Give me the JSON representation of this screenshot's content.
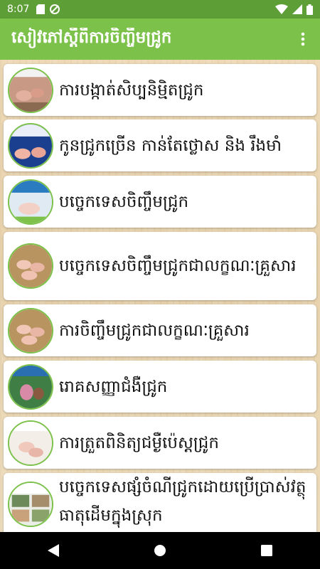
{
  "status_bar": {
    "time": "8:07",
    "icons": [
      "sd-card-icon",
      "sync-disabled-icon",
      "wifi-icon",
      "signal-icon",
      "battery-icon"
    ]
  },
  "app_bar": {
    "title": "សៀវភៅស្តីពីការចិញ្ចឹមជ្រូក",
    "overflow_icon": "more-vert-icon",
    "colors": {
      "bar": "#7cc14a",
      "status": "#5e9e36"
    }
  },
  "list": {
    "items": [
      {
        "title": "ការបង្កាត់សិប្បនិម្មិតជ្រូក",
        "thumb": "pig-photo-thumbnail"
      },
      {
        "title": "កូនជ្រូកច្រើន កាន់តែថ្លោស និង រឹងមាំ",
        "thumb": "pig-photo-thumbnail"
      },
      {
        "title": "បច្ចេកទេសចិញ្ចឹមជ្រូក",
        "thumb": "pig-photo-thumbnail"
      },
      {
        "title": "បច្ចេកទេសចិញ្ចឹមជ្រូកជាលក្ខណៈគ្រួសារ",
        "thumb": "pig-photo-thumbnail"
      },
      {
        "title": "ការចិញ្ចឹមជ្រូកជាលក្ខណៈគ្រួសារ",
        "thumb": "pig-photo-thumbnail"
      },
      {
        "title": "រោគសញ្ញាជំងឺជ្រូក",
        "thumb": "pig-photo-thumbnail"
      },
      {
        "title": "ការត្រួតពិនិត្យជម្ងឺប៉េស្តជ្រូក",
        "thumb": "pig-photo-thumbnail"
      },
      {
        "title": "បច្ចេកទេសផ្សំចំណីជ្រូកដោយប្រើប្រាស់វត្ថុធាតុដើមក្នុងស្រុក",
        "thumb": "pig-photo-thumbnail"
      }
    ]
  },
  "nav_bar": {
    "back_icon": "back-triangle-icon",
    "home_icon": "home-circle-icon",
    "recents_icon": "recents-square-icon"
  }
}
